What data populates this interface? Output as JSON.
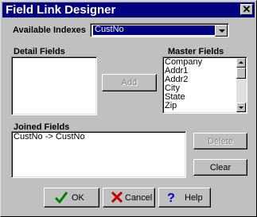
{
  "window": {
    "title": "Field Link Designer"
  },
  "indexes": {
    "label": "Available Indexes",
    "value": "CustNo"
  },
  "detail": {
    "label": "Detail Fields",
    "items": []
  },
  "master": {
    "label": "Master Fields",
    "items": [
      "Company",
      "Addr1",
      "Addr2",
      "City",
      "State",
      "Zip"
    ]
  },
  "add_label": "Add",
  "joined": {
    "label": "Joined Fields",
    "items": [
      "CustNo -> CustNo"
    ]
  },
  "delete_label": "Delete",
  "clear_label": "Clear",
  "ok_label": "OK",
  "cancel_label": "Cancel",
  "help_label": "Help",
  "colors": {
    "title_bar": "#000080",
    "face": "#c0c0c0",
    "ok_check": "#008000",
    "cancel_x": "#c00000",
    "help_mark": "#0000c0"
  }
}
